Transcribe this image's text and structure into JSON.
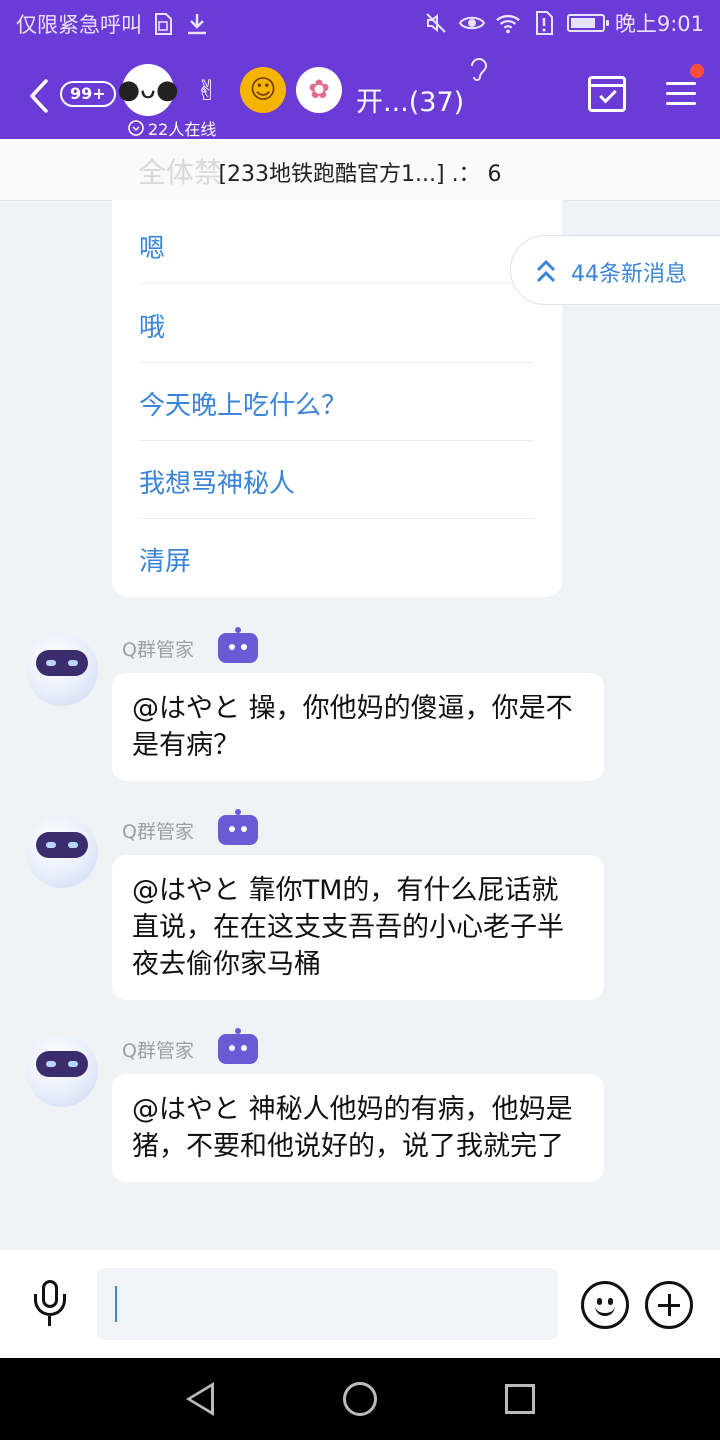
{
  "colors": {
    "header_bg": "#6a3bd6",
    "link_blue": "#3a84d9",
    "accent_red": "#ff4d3d"
  },
  "status_bar": {
    "left_text": "仅限紧急呼叫",
    "time": "晚上9:01",
    "icons": [
      "sim-icon",
      "download-icon",
      "mute-icon",
      "eye-icon",
      "wifi-icon",
      "sim-alert-icon",
      "battery-icon"
    ]
  },
  "header": {
    "unread_badge": "99+",
    "group_title": "开...(37)",
    "online_text": "22人在线",
    "avatars": [
      "rabbit-avatar",
      "hand-avatar",
      "girl-avatar",
      "paw-avatar"
    ]
  },
  "pinned": {
    "ghost_text": "全体禁",
    "text": "[233地铁跑酷官方1...] .： 6"
  },
  "quick_replies": [
    "嗯",
    "哦",
    "今天晚上吃什么？",
    "我想骂神秘人",
    "清屏"
  ],
  "new_messages": {
    "text": "44条新消息"
  },
  "messages": [
    {
      "sender": "Q群管家",
      "text": "@はやと 操，你他妈的傻逼，你是不是有病？"
    },
    {
      "sender": "Q群管家",
      "text": "@はやと 靠你TM的，有什么屁话就直说，在在这支支吾吾的小心老子半夜去偷你家马桶"
    },
    {
      "sender": "Q群管家",
      "text": "@はやと 神秘人他妈的有病，他妈是猪，不要和他说好的，说了我就完了"
    }
  ],
  "input": {
    "value": ""
  }
}
